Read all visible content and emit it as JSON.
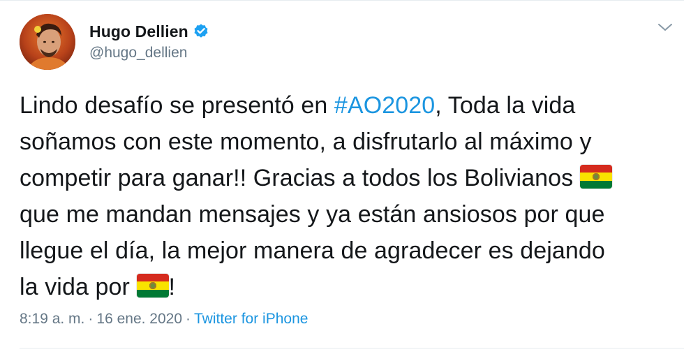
{
  "author": {
    "display_name": "Hugo Dellien",
    "handle": "@hugo_dellien",
    "verified": true
  },
  "tweet": {
    "lines": [
      {
        "pre": "Lindo desafío se presentó en ",
        "hashtag": "#AO2020",
        "post": ", Toda la vida"
      },
      {
        "text": "soñamos con este momento, a disfrutarlo al máximo y"
      },
      {
        "text": "competir para ganar!! Gracias a todos los Bolivianos "
      },
      {
        "text": " que me mandan mensajes y ya están ansiosos por que"
      },
      {
        "text": "llegue el día, la mejor manera de agradecer es dejando"
      },
      {
        "pre": "la vida por ",
        "post": "!"
      }
    ],
    "emoji_flag": "bolivia-flag-icon"
  },
  "meta": {
    "time": "8:19 a. m.",
    "separator1": "·",
    "date": "16 ene. 2020",
    "separator2": "·",
    "source": "Twitter for iPhone"
  },
  "colors": {
    "text": "#14171a",
    "secondary": "#657786",
    "link": "#1b95e0",
    "verified": "#1da1f2"
  },
  "icons": {
    "verified": "verified-badge-icon",
    "menu": "chevron-down-icon"
  }
}
